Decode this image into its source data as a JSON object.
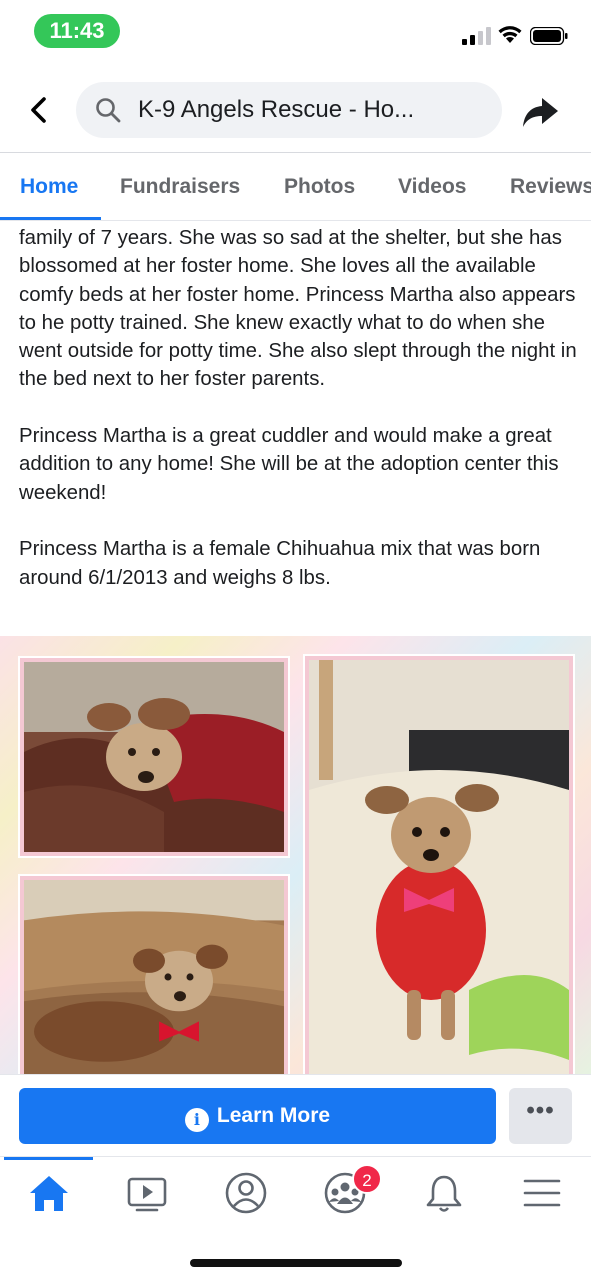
{
  "status_bar": {
    "time": "11:43"
  },
  "header": {
    "search_text": "K-9 Angels Rescue - Ho..."
  },
  "tabs": [
    {
      "label": "Home",
      "active": true
    },
    {
      "label": "Fundraisers",
      "active": false
    },
    {
      "label": "Photos",
      "active": false
    },
    {
      "label": "Videos",
      "active": false
    },
    {
      "label": "Reviews",
      "active": false
    }
  ],
  "post": {
    "paragraphs": [
      "family of 7 years.  She was so sad at the shelter, but she has blossomed at her foster home.  She loves all the available comfy beds at her foster home.  Princess Martha also appears to he potty trained.  She knew exactly what to do when she went outside for potty time. She also slept through the night in the bed next to her foster parents.",
      "Princess Martha is a great cuddler and would make a great addition to any home! She  will be at the adoption center this weekend!",
      "Princess Martha is a female Chihuahua mix that was born around 6/1/2013 and weighs 8 lbs."
    ]
  },
  "action": {
    "learn_more_label": "Learn More",
    "more_label": "•••"
  },
  "bottom_nav": {
    "items": [
      "home-icon",
      "watch-icon",
      "profile-icon",
      "groups-icon",
      "notifications-icon",
      "menu-icon"
    ],
    "groups_badge": "2"
  },
  "colors": {
    "accent": "#1877f2",
    "badge": "#f02849",
    "status_pill": "#34c759"
  }
}
